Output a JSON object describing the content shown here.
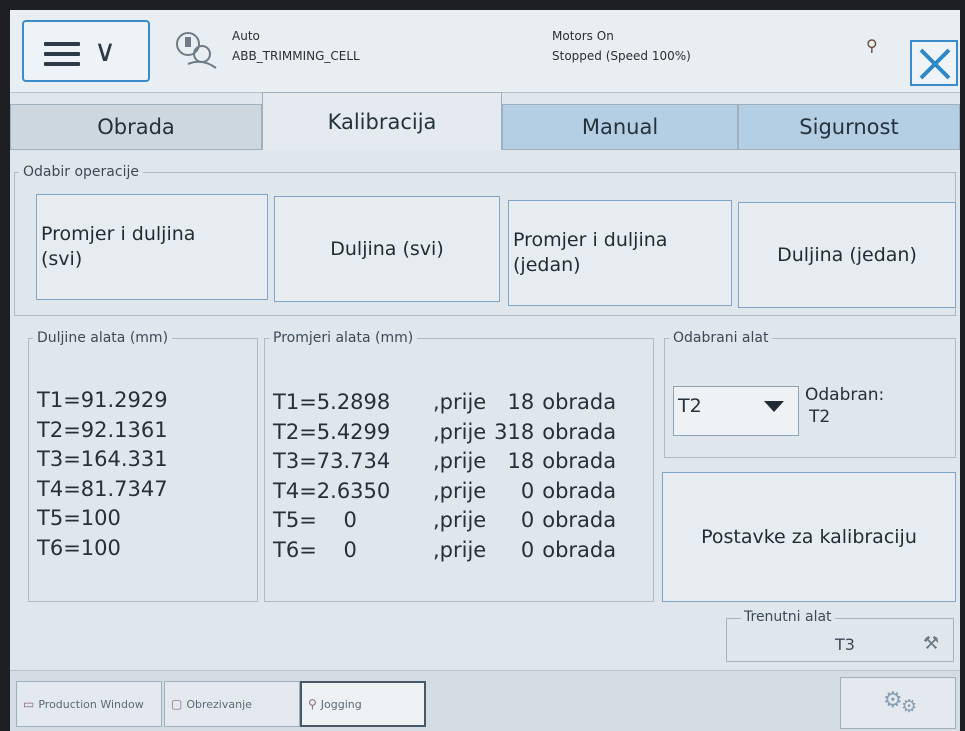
{
  "status": {
    "mode": "Auto",
    "cell": "ABB_TRIMMING_CELL",
    "motors": "Motors On",
    "state": "Stopped (Speed 100%)"
  },
  "icons": {
    "menu": "hamburger-menu-icon",
    "user": "user-icon",
    "pin": "pin-icon",
    "close": "close-icon",
    "gear": "gear-icon",
    "wrench": "wrench-icon"
  },
  "tabs": [
    {
      "label": "Obrada"
    },
    {
      "label": "Kalibracija"
    },
    {
      "label": "Manual"
    },
    {
      "label": "Sigurnost"
    }
  ],
  "operation": {
    "legend": "Odabir operacije",
    "buttons": [
      {
        "line1": "Promjer i duljina",
        "line2": "(svi)"
      },
      {
        "label": "Duljina (svi)"
      },
      {
        "line1": "Promjer i duljina",
        "line2": "(jedan)"
      },
      {
        "label": "Duljina (jedan)"
      }
    ]
  },
  "lengths": {
    "legend": "Duljine alata (mm)",
    "items": [
      "T1=91.2929",
      "T2=92.1361",
      "T3=164.331",
      "T4=81.7347",
      "T5=100",
      "T6=100"
    ]
  },
  "diameters": {
    "legend": "Promjeri alata (mm)",
    "rows": [
      {
        "val": "T1=5.2898",
        "prije": ",prije",
        "count": "18",
        "obrada": "obrada"
      },
      {
        "val": "T2=5.4299",
        "prije": ",prije",
        "count": "318",
        "obrada": "obrada"
      },
      {
        "val": "T3=73.734",
        "prije": ",prije",
        "count": "18",
        "obrada": "obrada"
      },
      {
        "val": "T4=2.6350",
        "prije": ",prije",
        "count": "0",
        "obrada": "obrada"
      },
      {
        "val": "T5=    0",
        "prije": ",prije",
        "count": "0",
        "obrada": "obrada"
      },
      {
        "val": "T6=    0",
        "prije": ",prije",
        "count": "0",
        "obrada": "obrada"
      }
    ]
  },
  "selected_tool": {
    "legend": "Odabrani alat",
    "value": "T2",
    "label": "Odabran:",
    "label_value": "T2"
  },
  "calibration_button": "Postavke za kalibraciju",
  "current_tool": {
    "legend": "Trenutni alat",
    "value": "T3"
  },
  "taskbar": {
    "items": [
      "Production Window",
      "Obrezivanje",
      "Jogging"
    ]
  }
}
